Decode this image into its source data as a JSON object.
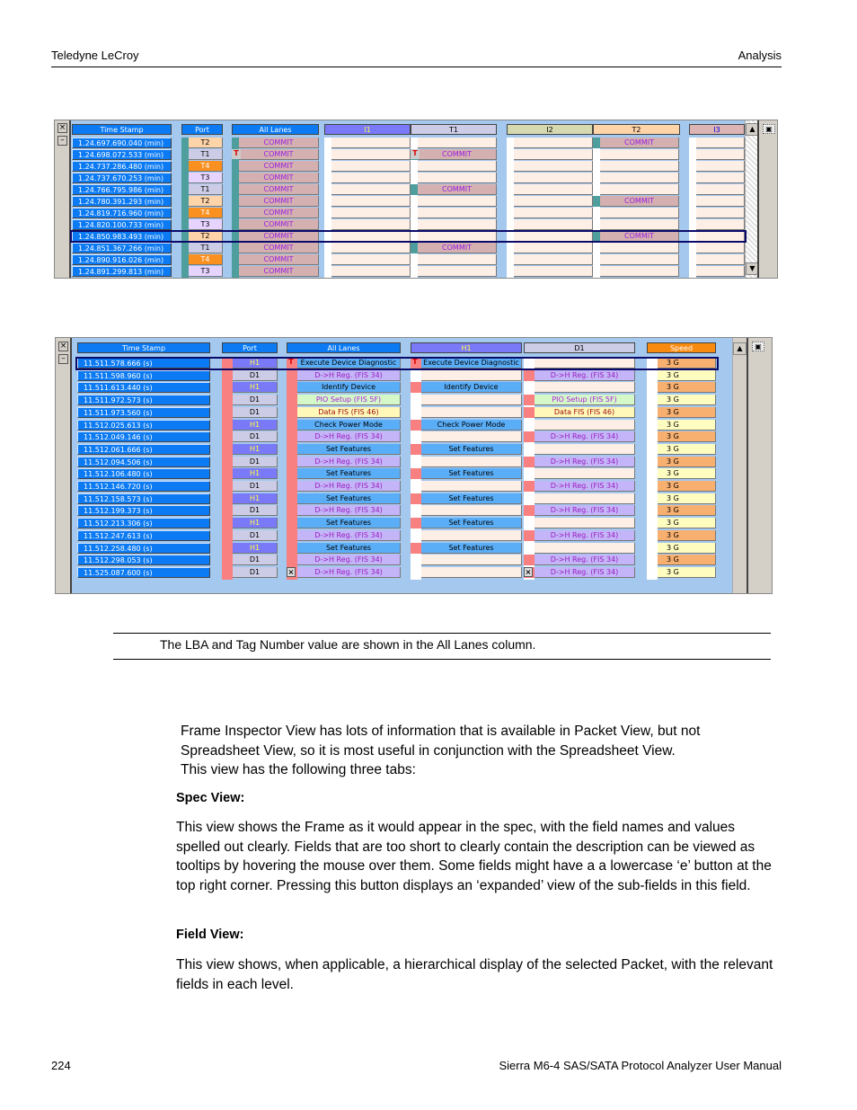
{
  "page": {
    "header_left": "Teledyne LeCroy",
    "header_right": "Analysis",
    "footer_left": "224",
    "footer_right": "Sierra M6-4 SAS/SATA Protocol Analyzer User Manual"
  },
  "spreadsheet1": {
    "columns": [
      "Time Stamp",
      "Port",
      "All Lanes",
      "I1",
      "T1",
      "I2",
      "T2",
      "I3"
    ],
    "selected_row": 8,
    "rows": [
      {
        "ts": "1.24.697.690.040 (min)",
        "port": "T2",
        "all": "COMMIT",
        "lane": "T2",
        "marker": ""
      },
      {
        "ts": "1.24.698.072.533 (min)",
        "port": "T1",
        "all": "COMMIT",
        "lane": "T1",
        "marker": "T"
      },
      {
        "ts": "1.24.737.286.480 (min)",
        "port": "T4",
        "all": "COMMIT",
        "lane": "",
        "marker": ""
      },
      {
        "ts": "1.24.737.670.253 (min)",
        "port": "T3",
        "all": "COMMIT",
        "lane": "",
        "marker": ""
      },
      {
        "ts": "1.24.766.795.986 (min)",
        "port": "T1",
        "all": "COMMIT",
        "lane": "T1",
        "marker": ""
      },
      {
        "ts": "1.24.780.391.293 (min)",
        "port": "T2",
        "all": "COMMIT",
        "lane": "T2",
        "marker": ""
      },
      {
        "ts": "1.24.819.716.960 (min)",
        "port": "T4",
        "all": "COMMIT",
        "lane": "",
        "marker": ""
      },
      {
        "ts": "1.24.820.100.733 (min)",
        "port": "T3",
        "all": "COMMIT",
        "lane": "",
        "marker": ""
      },
      {
        "ts": "1.24.850.983.493 (min)",
        "port": "T2",
        "all": "COMMIT",
        "lane": "T2",
        "marker": ""
      },
      {
        "ts": "1.24.851.367.266 (min)",
        "port": "T1",
        "all": "COMMIT",
        "lane": "T1",
        "marker": ""
      },
      {
        "ts": "1.24.890.916.026 (min)",
        "port": "T4",
        "all": "COMMIT",
        "lane": "",
        "marker": ""
      },
      {
        "ts": "1.24.891.299.813 (min)",
        "port": "T3",
        "all": "COMMIT",
        "lane": "",
        "marker": ""
      }
    ]
  },
  "spreadsheet2": {
    "columns": [
      "Time Stamp",
      "Port",
      "All Lanes",
      "H1",
      "D1",
      "Speed"
    ],
    "selected_row": 0,
    "rows": [
      {
        "ts": "11.511.578.666 (s)",
        "port": "H1",
        "all": "Execute Device Diagnostic",
        "speed": "3 G",
        "marker": "T"
      },
      {
        "ts": "11.511.598.960 (s)",
        "port": "D1",
        "all": "D->H Reg. (FIS 34)",
        "speed": "3 G",
        "marker": ""
      },
      {
        "ts": "11.511.613.440 (s)",
        "port": "H1",
        "all": "Identify Device",
        "speed": "3 G",
        "marker": ""
      },
      {
        "ts": "11.511.972.573 (s)",
        "port": "D1",
        "all": "PIO Setup (FIS 5F)",
        "speed": "3 G",
        "marker": ""
      },
      {
        "ts": "11.511.973.560 (s)",
        "port": "D1",
        "all": "Data FIS (FIS 46)",
        "speed": "3 G",
        "marker": ""
      },
      {
        "ts": "11.512.025.613 (s)",
        "port": "H1",
        "all": "Check Power Mode",
        "speed": "3 G",
        "marker": ""
      },
      {
        "ts": "11.512.049.146 (s)",
        "port": "D1",
        "all": "D->H Reg. (FIS 34)",
        "speed": "3 G",
        "marker": ""
      },
      {
        "ts": "11.512.061.666 (s)",
        "port": "H1",
        "all": "Set Features",
        "speed": "3 G",
        "marker": ""
      },
      {
        "ts": "11.512.094.506 (s)",
        "port": "D1",
        "all": "D->H Reg. (FIS 34)",
        "speed": "3 G",
        "marker": ""
      },
      {
        "ts": "11.512.106.480 (s)",
        "port": "H1",
        "all": "Set Features",
        "speed": "3 G",
        "marker": ""
      },
      {
        "ts": "11.512.146.720 (s)",
        "port": "D1",
        "all": "D->H Reg. (FIS 34)",
        "speed": "3 G",
        "marker": ""
      },
      {
        "ts": "11.512.158.573 (s)",
        "port": "H1",
        "all": "Set Features",
        "speed": "3 G",
        "marker": ""
      },
      {
        "ts": "11.512.199.373 (s)",
        "port": "D1",
        "all": "D->H Reg. (FIS 34)",
        "speed": "3 G",
        "marker": ""
      },
      {
        "ts": "11.512.213.306 (s)",
        "port": "H1",
        "all": "Set Features",
        "speed": "3 G",
        "marker": ""
      },
      {
        "ts": "11.512.247.613 (s)",
        "port": "D1",
        "all": "D->H Reg. (FIS 34)",
        "speed": "3 G",
        "marker": ""
      },
      {
        "ts": "11.512.258.480 (s)",
        "port": "H1",
        "all": "Set Features",
        "speed": "3 G",
        "marker": ""
      },
      {
        "ts": "11.512.298.053 (s)",
        "port": "D1",
        "all": "D->H Reg. (FIS 34)",
        "speed": "3 G",
        "marker": ""
      },
      {
        "ts": "11.525.087.600 (s)",
        "port": "D1",
        "all": "D->H Reg. (FIS 34)",
        "speed": "3 G",
        "marker": "X"
      }
    ]
  },
  "note": "The LBA and Tag Number value are shown in the All Lanes column.",
  "body": {
    "intro": "Frame Inspector View has lots of information that is available in Packet View, but not Spreadsheet View, so it is most useful in conjunction with the Spreadsheet View.",
    "intro2": "This view has the following three tabs:",
    "spec_heading": "Spec View:",
    "spec_text": "This view shows the Frame as it would appear in the spec, with the field names and values spelled out clearly. Fields that are too short to clearly contain the description can be viewed as tooltips by hovering the mouse over them. Some fields might have a a lowercase ‘e’ button at the top right corner. Pressing this button displays an ‘expanded’ view of the sub-fields in this field.",
    "field_heading": "Field View:",
    "field_text": "This view shows, when applicable, a hierarchical display of the selected Packet, with the relevant fields in each level."
  },
  "colors": {
    "timestamp_bg": "#0b7af3",
    "grid_bg": "#a4c8ee",
    "commit_bg": "#d4b0b0",
    "commit_text": "#9a20e0",
    "empty_cell": "#fdeee6",
    "selection": "#0a0a6a"
  }
}
